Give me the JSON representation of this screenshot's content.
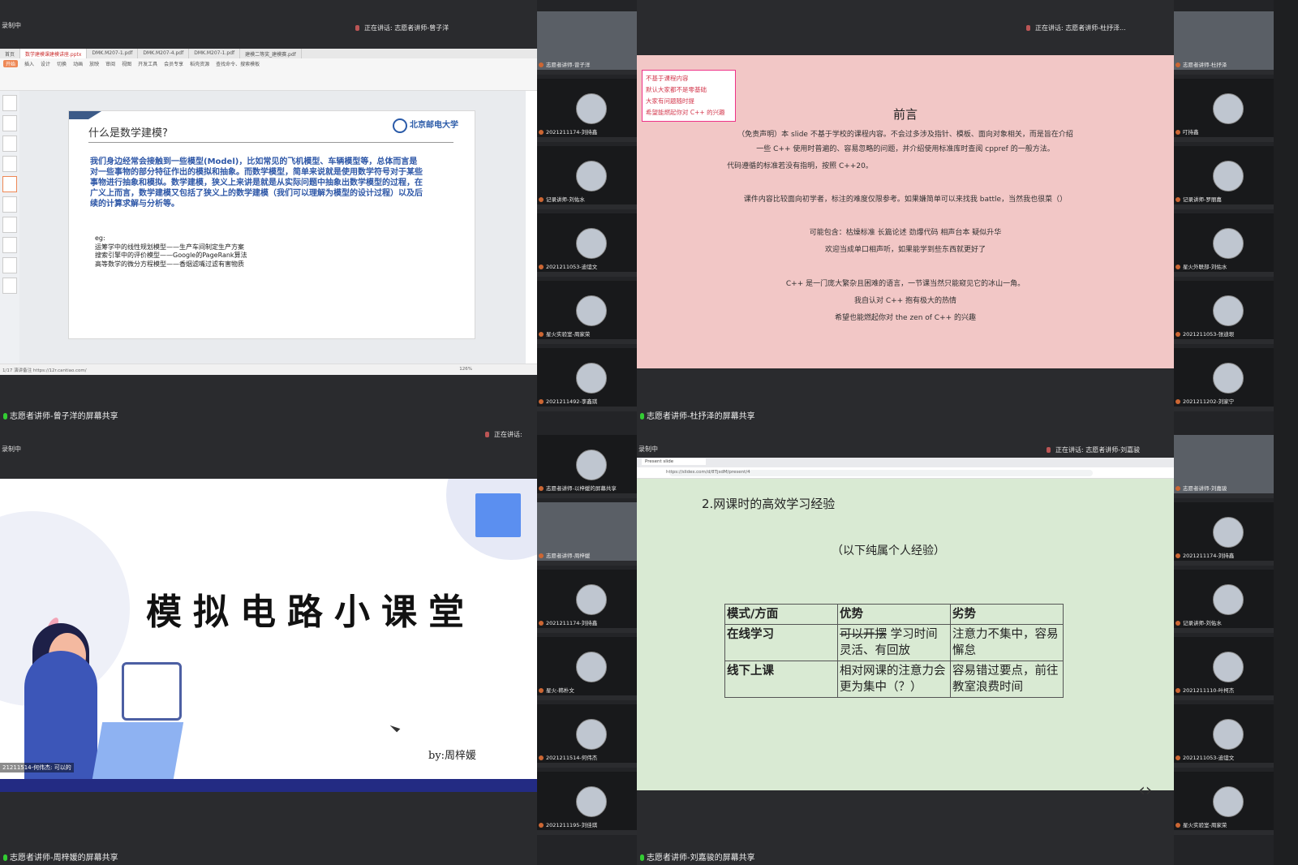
{
  "q1": {
    "rec": "录制中",
    "speaking": "正在讲话: 志愿者讲师-曾子洋",
    "tabs": [
      "首页",
      "数学建模课建模讲座.pptx",
      "DMK.M207-1.pdf",
      "DMK.M207-4.pdf",
      "DMK.M207-1.pdf",
      "建模二等奖_建模赛.pdf"
    ],
    "menu": [
      "开始",
      "插入",
      "设计",
      "切换",
      "动画",
      "放映",
      "审阅",
      "视图",
      "开发工具",
      "会员专享",
      "稻壳资源",
      "查找命令、搜索模板"
    ],
    "slide_title": "什么是数学建模?",
    "logo": "北京邮电大学",
    "body": "我们身边经常会接触到一些模型(Model)，比如常见的飞机模型、车辆模型等，总体而言是对一些事物的部分特征作出的模拟和抽象。而数学模型，简单来说就是使用数学符号对于某些事物进行抽象和模拟。数学建模，狭义上来讲是就是从实际问题中抽象出数学模型的过程，在广义上而言，数学建模又包括了狭义上的数学建模（我们可以理解为模型的设计过程）以及后续的计算求解与分析等。",
    "eg": "eg:",
    "eg_lines": [
      "运筹学中的线性规划模型——生产车间制定生产方案",
      "搜索引擎中的评价模型——Google的PageRank算法",
      "高等数学的微分方程模型——香烟滤嘴过滤有害物质"
    ],
    "status": "1/17  演讲备注 https://12r.cantiao.com/",
    "zoom": "126%",
    "label": "志愿者讲师-曾子洋的屏幕共享"
  },
  "strip1": [
    {
      "name": "志愿者讲师-曾子洋",
      "cam": true
    },
    {
      "name": "2021211174-刘持鑫"
    },
    {
      "name": "记录讲师-刘佑水"
    },
    {
      "name": "2021211053-迪谊文"
    },
    {
      "name": "星火实验室-周家荣"
    },
    {
      "name": "2021211492-李鑫琪"
    }
  ],
  "q2": {
    "speaking": "正在讲话: 志愿者讲师-杜抒泽...",
    "notes": [
      "不基于课程内容",
      "默认大家都不是零基础",
      "大家有问题随时提",
      "希望能燃起你对 C++ 的兴趣"
    ],
    "title": "前言",
    "lines": [
      "（免责声明）本 slide 不基于学校的课程内容。不会过多涉及指针、模板、面向对象相关，而是旨在介绍",
      "一些 C++ 使用时普遍的、容易忽略的问题，并介绍使用标准库时查阅 cppref 的一般方法。",
      "代码遵循的标准若没有指明，按照 C++20。",
      "课件内容比较面向初学者，标注的难度仅限参考。如果嫌简单可以来找我 battle，当然我也很菜（）",
      "可能包含：枯燥标准  长篇论述  劲爆代码  相声台本  疑似升华",
      "欢迎当成单口相声听，如果能学到些东西就更好了",
      "C++ 是一门庞大繁杂且困难的语言，一节课当然只能窥见它的冰山一角。",
      "我自认对 C++ 抱有极大的热情",
      "希望也能燃起你对 the zen of C++ 的兴趣"
    ],
    "label": "志愿者讲师-杜抒泽的屏幕共享"
  },
  "strip2": [
    {
      "name": "志愿者讲师-杜抒泽",
      "cam": true
    },
    {
      "name": "叮持鑫"
    },
    {
      "name": "记录讲师-罗丽嘉"
    },
    {
      "name": "星火外联部-刘佑水"
    },
    {
      "name": "2021211053-张迪垠"
    },
    {
      "name": "2021211202-刘家宁"
    }
  ],
  "q3": {
    "rec": "录制中",
    "speaking": "正在讲话:",
    "title": "模拟电路小课堂",
    "by": "by:周梓媛",
    "viewer": "21211514-何伟杰: 可以的",
    "label": "志愿者讲师-周梓媛的屏幕共享"
  },
  "strip3": [
    {
      "name": "志愿者讲师-以梓媛的屏幕共享"
    },
    {
      "name": "志愿者讲师-周梓媛",
      "cam": true
    },
    {
      "name": "2021211174-刘持鑫"
    },
    {
      "name": "星火-韩朴文"
    },
    {
      "name": "2021211514-何伟杰"
    },
    {
      "name": "2021211195-刘佳琪"
    }
  ],
  "q4": {
    "rec": "录制中",
    "speaking": "正在讲话: 志愿者讲师-刘嘉骏",
    "tab": "Present slide",
    "url": "https://slides.com/d/8TjsdM/present/4",
    "heading": "2.网课时的高效学习经验",
    "sub": "（以下纯属个人经验）",
    "table": {
      "headers": [
        "模式/方面",
        "优势",
        "劣势"
      ],
      "rows": [
        {
          "mode": "在线学习",
          "pro_strike": "可以开摆",
          "pro": " 学习时间灵活、有回放",
          "con": "注意力不集中，容易懈怠"
        },
        {
          "mode": "线下上课",
          "pro_strike": "",
          "pro": "相对网课的注意力会更为集中（？）",
          "con": "容易错过要点，前往教室浪费时间"
        }
      ]
    },
    "nav": "‹›",
    "label": "志愿者讲师-刘嘉骏的屏幕共享"
  },
  "strip4": [
    {
      "name": "志愿者讲师-刘嘉骏",
      "cam": true
    },
    {
      "name": "2021211174-刘持鑫"
    },
    {
      "name": "记录讲师-刘佑水"
    },
    {
      "name": "2021211110-叶柯杰"
    },
    {
      "name": "2021211053-迪谊文"
    },
    {
      "name": "星火实验室-周家荣"
    }
  ],
  "colors": {
    "pink": "#f2c7c6",
    "green": "#d9ead3",
    "navy": "#232b83",
    "mic": "#33cc33"
  }
}
